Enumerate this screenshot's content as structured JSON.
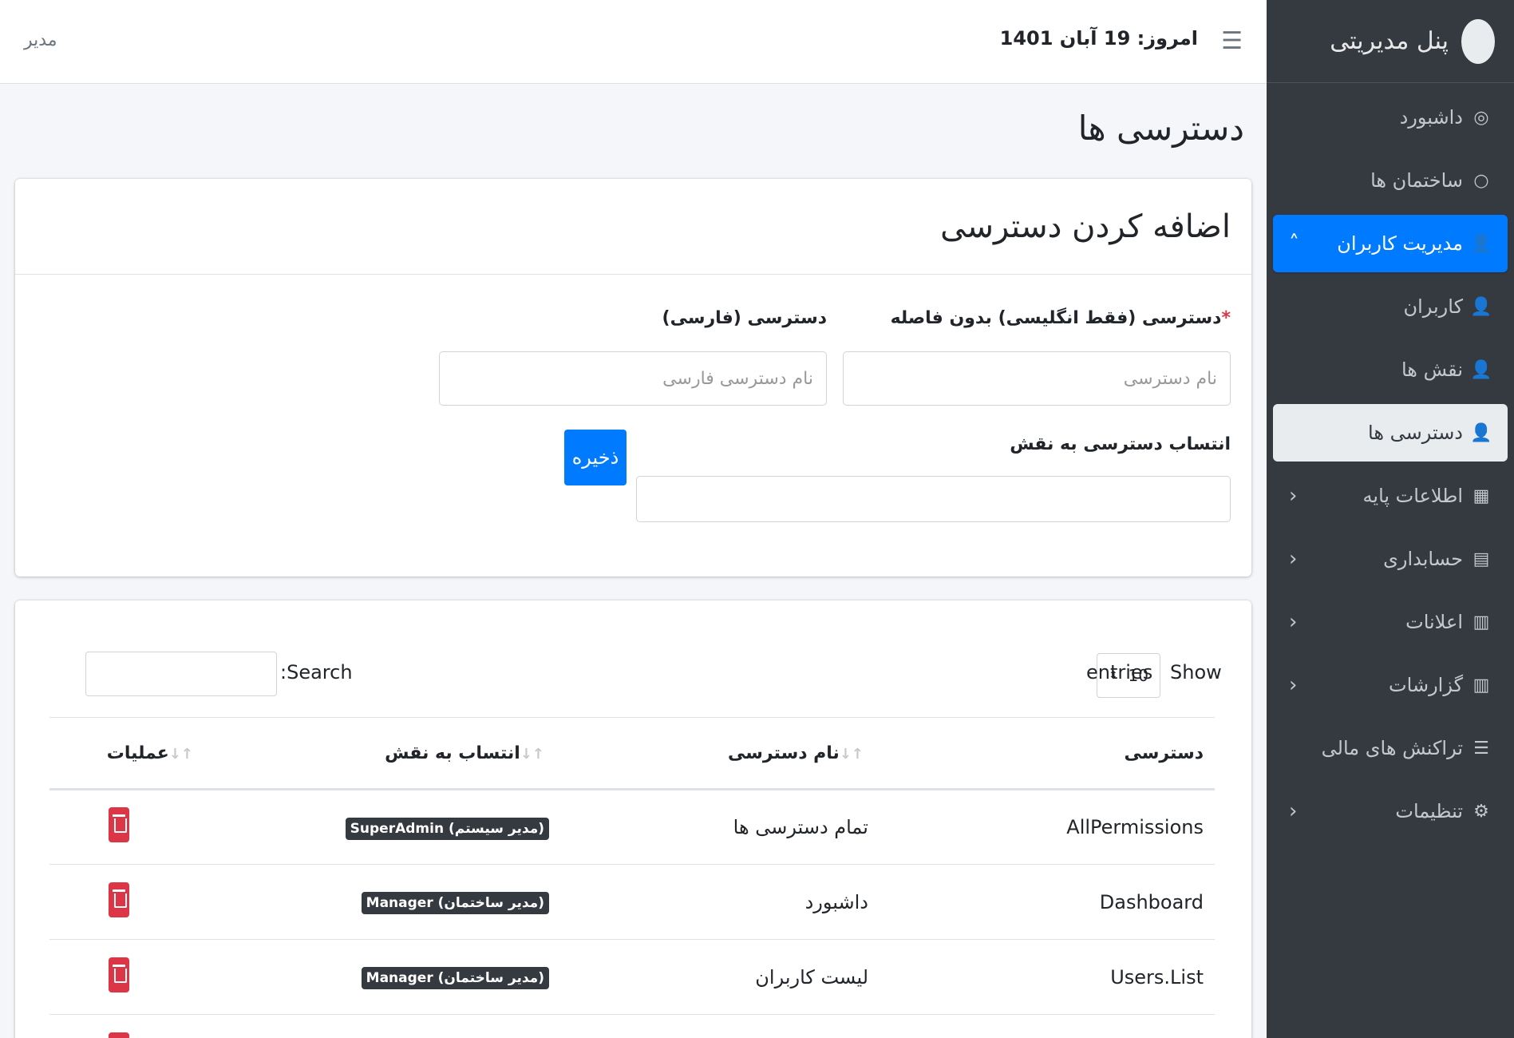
{
  "header": {
    "menu_icon": "hamburger-icon",
    "today": "امروز: 19 آبان 1401",
    "user": "مدیر"
  },
  "sidebar": {
    "brand": "پنل مدیریتی",
    "items": [
      {
        "label": "داشبورد",
        "icon": "gauge-icon"
      },
      {
        "label": "ساختمان ها",
        "icon": "circle-icon"
      },
      {
        "label": "مدیریت کاربران",
        "icon": "user-icon",
        "active": true
      },
      {
        "label": "کاربران",
        "icon": "user-icon"
      },
      {
        "label": "نقش ها",
        "icon": "user-icon"
      },
      {
        "label": "دسترسی ها",
        "icon": "user-icon",
        "current": true
      },
      {
        "label": "اطلاعات پایه",
        "icon": "building-icon"
      },
      {
        "label": "حسابداری",
        "icon": "calculator-icon"
      },
      {
        "label": "اعلانات",
        "icon": "clipboard-icon"
      },
      {
        "label": "گزارشات",
        "icon": "clipboard-icon"
      },
      {
        "label": "تراکنش های مالی",
        "icon": "list-icon"
      },
      {
        "label": "تنظیمات",
        "icon": "gear-icon"
      }
    ]
  },
  "page": {
    "title": "دسترسی ها"
  },
  "form": {
    "title": "اضافه کردن دسترسی",
    "name_label": "دسترسی (فقط انگلیسی) بدون فاصله",
    "required_mark": "*",
    "name_placeholder": "نام دسترسی",
    "fa_label": "دسترسی (فارسی)",
    "fa_placeholder": "نام دسترسی فارسی",
    "role_label": "انتساب دسترسی به نقش",
    "save_label": "ذخیره"
  },
  "table": {
    "show_label": "Show",
    "page_length": "10",
    "entries_label": "entries",
    "search_label": ":Search",
    "columns": [
      "دسترسی",
      "نام دسترسی",
      "انتساب به نقش",
      "عملیات"
    ],
    "rows": [
      {
        "permission": "AllPermissions",
        "name": "تمام دسترسی ها",
        "role": "SuperAdmin (مدیر سیستم)"
      },
      {
        "permission": "Dashboard",
        "name": "داشبورد",
        "role": "Manager (مدیر ساختمان)"
      },
      {
        "permission": "Users.List",
        "name": "لیست کاربران",
        "role": "Manager (مدیر ساختمان)"
      }
    ]
  }
}
